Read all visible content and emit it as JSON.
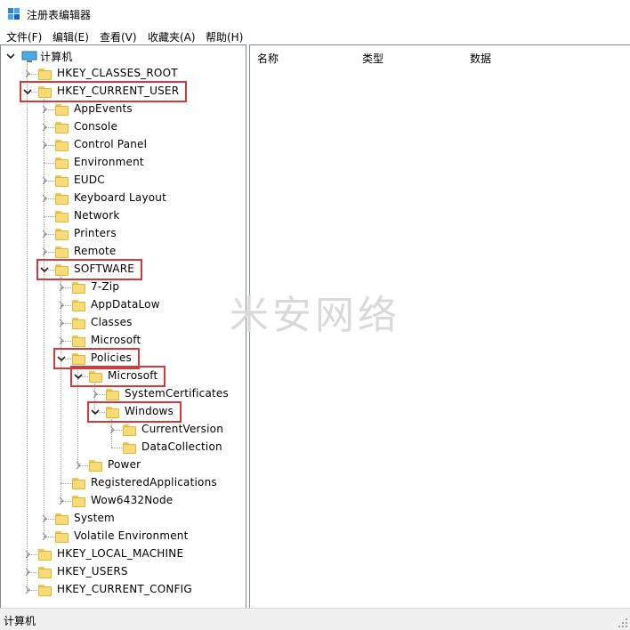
{
  "window": {
    "title": "注册表编辑器",
    "icon": "regedit-icon"
  },
  "menu": [
    {
      "label": "文件(F)"
    },
    {
      "label": "编辑(E)"
    },
    {
      "label": "查看(V)"
    },
    {
      "label": "收藏夹(A)"
    },
    {
      "label": "帮助(H)"
    }
  ],
  "columns": {
    "name": "名称",
    "type": "类型",
    "data": "数据"
  },
  "tree": [
    {
      "label": "计算机",
      "level": 0,
      "state": "expanded",
      "icon": "computer-icon"
    },
    {
      "label": "HKEY_CLASSES_ROOT",
      "level": 1,
      "state": "collapsed"
    },
    {
      "label": "HKEY_CURRENT_USER",
      "level": 1,
      "state": "expanded",
      "highlight": true
    },
    {
      "label": "AppEvents",
      "level": 2,
      "state": "collapsed"
    },
    {
      "label": "Console",
      "level": 2,
      "state": "collapsed"
    },
    {
      "label": "Control Panel",
      "level": 2,
      "state": "collapsed"
    },
    {
      "label": "Environment",
      "level": 2,
      "state": "leaf"
    },
    {
      "label": "EUDC",
      "level": 2,
      "state": "collapsed"
    },
    {
      "label": "Keyboard Layout",
      "level": 2,
      "state": "collapsed"
    },
    {
      "label": "Network",
      "level": 2,
      "state": "leaf"
    },
    {
      "label": "Printers",
      "level": 2,
      "state": "collapsed"
    },
    {
      "label": "Remote",
      "level": 2,
      "state": "collapsed"
    },
    {
      "label": "SOFTWARE",
      "level": 2,
      "state": "expanded",
      "highlight": true
    },
    {
      "label": "7-Zip",
      "level": 3,
      "state": "collapsed"
    },
    {
      "label": "AppDataLow",
      "level": 3,
      "state": "collapsed"
    },
    {
      "label": "Classes",
      "level": 3,
      "state": "collapsed"
    },
    {
      "label": "Microsoft",
      "level": 3,
      "state": "collapsed"
    },
    {
      "label": "Policies",
      "level": 3,
      "state": "expanded",
      "highlight": true
    },
    {
      "label": "Microsoft",
      "level": 4,
      "state": "expanded",
      "highlight": true
    },
    {
      "label": "SystemCertificates",
      "level": 5,
      "state": "collapsed"
    },
    {
      "label": "Windows",
      "level": 5,
      "state": "expanded",
      "highlight": true
    },
    {
      "label": "CurrentVersion",
      "level": 6,
      "state": "collapsed"
    },
    {
      "label": "DataCollection",
      "level": 6,
      "state": "leaf"
    },
    {
      "label": "Power",
      "level": 4,
      "state": "collapsed"
    },
    {
      "label": "RegisteredApplications",
      "level": 3,
      "state": "leaf"
    },
    {
      "label": "Wow6432Node",
      "level": 3,
      "state": "collapsed"
    },
    {
      "label": "System",
      "level": 2,
      "state": "collapsed"
    },
    {
      "label": "Volatile Environment",
      "level": 2,
      "state": "collapsed"
    },
    {
      "label": "HKEY_LOCAL_MACHINE",
      "level": 1,
      "state": "collapsed"
    },
    {
      "label": "HKEY_USERS",
      "level": 1,
      "state": "collapsed"
    },
    {
      "label": "HKEY_CURRENT_CONFIG",
      "level": 1,
      "state": "collapsed"
    }
  ],
  "watermark": "米安网络",
  "status": {
    "path": "计算机"
  },
  "colors": {
    "highlight_border": "#d43a3a",
    "folder": "#f8da76"
  }
}
